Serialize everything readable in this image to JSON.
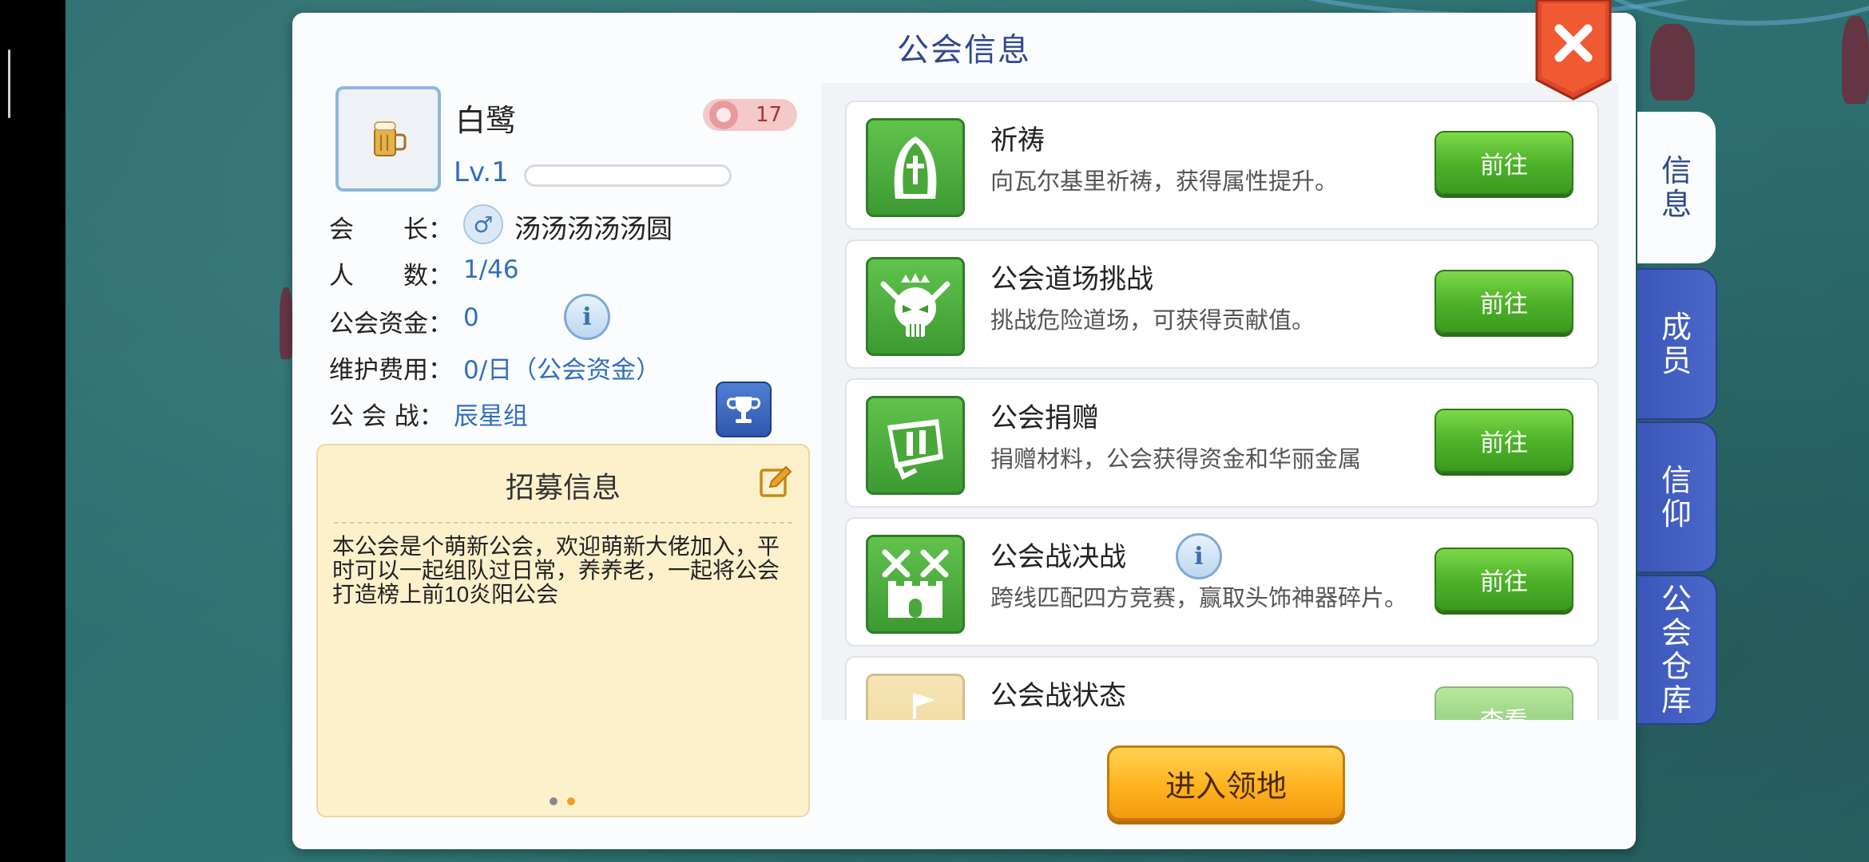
{
  "panel": {
    "title": "公会信息"
  },
  "guild": {
    "name": "白鹭",
    "rank": "17",
    "level": "Lv.1",
    "level_progress": 0
  },
  "info_rows": [
    {
      "label": "会　　长：",
      "value": "汤汤汤汤汤圆"
    },
    {
      "label": "人　　数：",
      "value": "1/46"
    },
    {
      "label": "公会资金：",
      "value": "0"
    },
    {
      "label": "维护费用：",
      "value": "0/日（公会资金）"
    },
    {
      "label": "公 会 战：",
      "value": "辰星组"
    }
  ],
  "recruit": {
    "title": "招募信息",
    "text": "本公会是个萌新公会，欢迎萌新大佬加入，平时可以一起组队过日常，养养老，一起将公会打造榜上前10炎阳公会",
    "page_dots": [
      "inactive",
      "active"
    ]
  },
  "activities": [
    {
      "title": "祈祷",
      "desc": "向瓦尔基里祈祷，获得属性提升。",
      "button": "前往",
      "icon": "prayer-icon"
    },
    {
      "title": "公会道场挑战",
      "desc": "挑战危险道场，可获得贡献值。",
      "button": "前往",
      "icon": "demon-skull-icon"
    },
    {
      "title": "公会捐赠",
      "desc": "捐赠材料，公会获得资金和华丽金属",
      "button": "前往",
      "icon": "donation-icon"
    },
    {
      "title": "公会战决战",
      "desc": "跨线匹配四方竞赛，赢取头饰神器碎片。",
      "button": "前往",
      "icon": "castle-battle-icon"
    },
    {
      "title": "公会战状态",
      "desc": "",
      "button": "查看",
      "icon": "castle-flag-icon"
    }
  ],
  "enter_button": "进入领地",
  "tabs": [
    {
      "label": "信息",
      "active": true
    },
    {
      "label": "成员",
      "active": false
    },
    {
      "label": "信仰",
      "active": false
    },
    {
      "label": "公会仓库",
      "active": false
    }
  ],
  "colors": {
    "title_blue": "#2e4a8a",
    "value_blue": "#2f6fc0",
    "green_button": "#4fb32a",
    "orange_button": "#ffb21e",
    "tab_blue": "#3a56b8",
    "close_red": "#e0462a"
  }
}
